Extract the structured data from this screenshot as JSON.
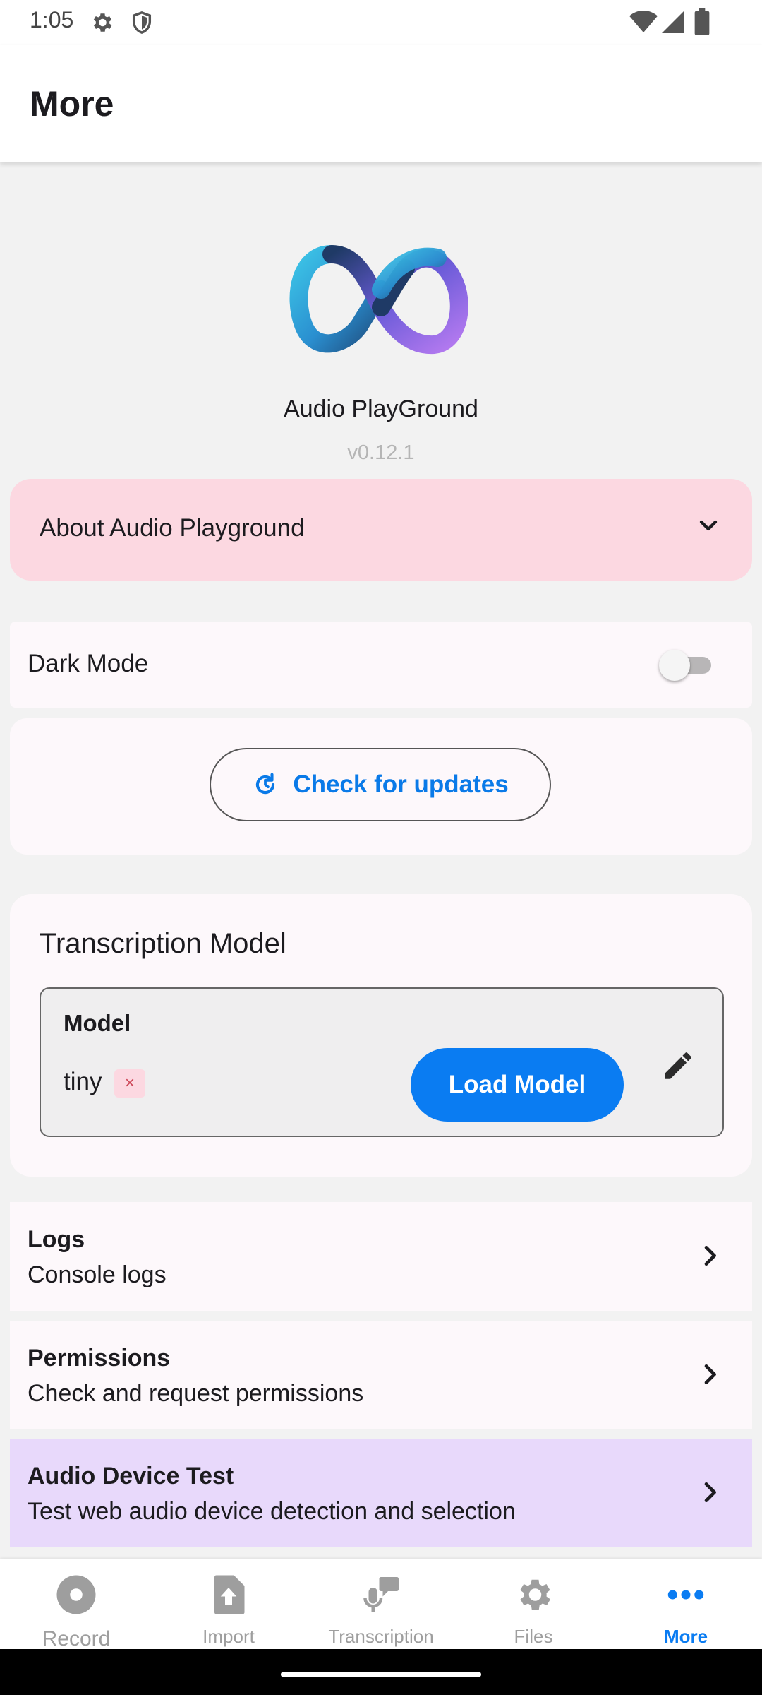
{
  "status_bar": {
    "time": "1:05"
  },
  "header": {
    "title": "More"
  },
  "app": {
    "name": "Audio PlayGround",
    "version": "v0.12.1"
  },
  "about": {
    "label": "About Audio Playground"
  },
  "dark_mode": {
    "label": "Dark Mode",
    "enabled": false
  },
  "updates": {
    "button_label": "Check for updates"
  },
  "transcription": {
    "heading": "Transcription Model",
    "field_label": "Model",
    "model_value": "tiny",
    "clear_label": "×",
    "load_button": "Load Model"
  },
  "list": [
    {
      "title": "Logs",
      "subtitle": "Console logs"
    },
    {
      "title": "Permissions",
      "subtitle": "Check and request permissions"
    },
    {
      "title": "Audio Device Test",
      "subtitle": "Test web audio device detection and selection"
    }
  ],
  "nav": [
    {
      "label": "Record",
      "icon": "record-icon"
    },
    {
      "label": "Import",
      "icon": "import-icon"
    },
    {
      "label": "Transcription",
      "icon": "transcription-icon"
    },
    {
      "label": "Files",
      "icon": "files-icon"
    },
    {
      "label": "More",
      "icon": "more-icon",
      "active": true
    }
  ],
  "colors": {
    "accent": "#0a7cf2",
    "about_bg": "#fcd8e1",
    "audio_test_bg": "#e8d9fb"
  }
}
